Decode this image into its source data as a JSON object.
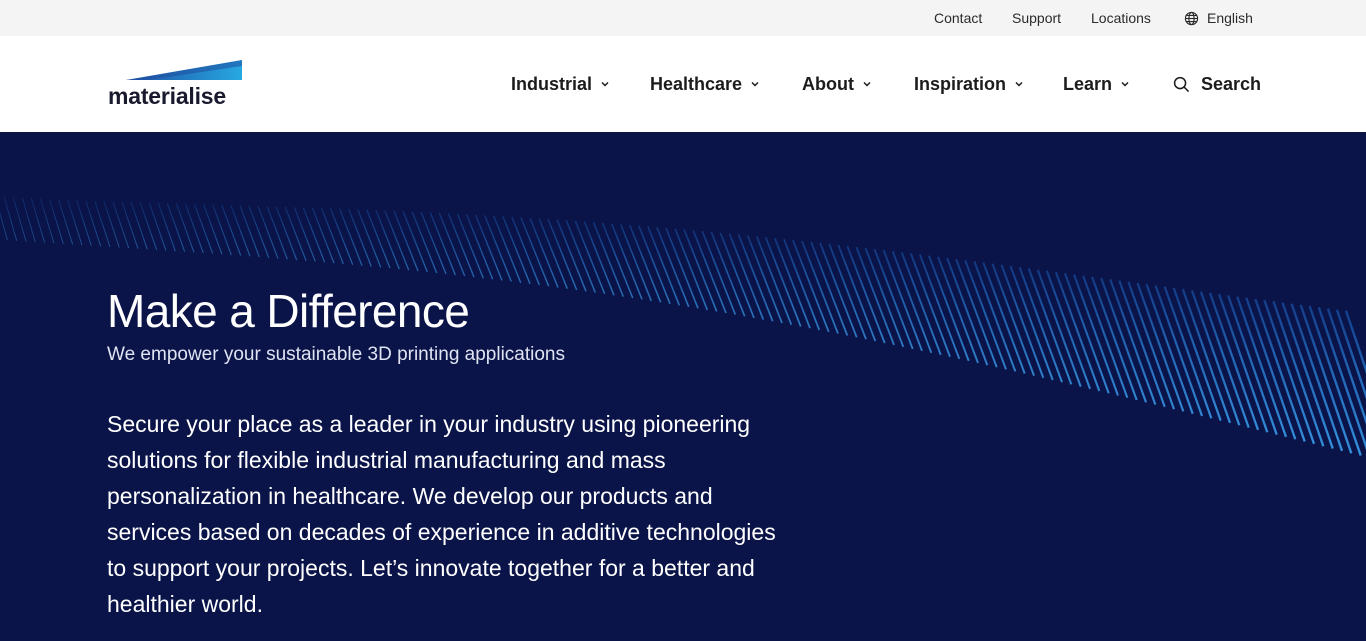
{
  "utility_nav": {
    "contact": "Contact",
    "support": "Support",
    "locations": "Locations",
    "language": "English",
    "language_icon": "globe-icon"
  },
  "logo": {
    "text": "materialise",
    "colors": {
      "light": "#27a8e0",
      "dark": "#1f4fa3"
    }
  },
  "main_nav": {
    "items": [
      {
        "label": "Industrial"
      },
      {
        "label": "Healthcare"
      },
      {
        "label": "About"
      },
      {
        "label": "Inspiration"
      },
      {
        "label": "Learn"
      }
    ],
    "dropdown_icon": "chevron-down-icon",
    "search_label": "Search",
    "search_icon": "search-icon"
  },
  "hero": {
    "title": "Make a Difference",
    "subtitle": "We empower your sustainable 3D printing applications",
    "body": "Secure your place as a leader in your industry using pioneering solutions for flexible industrial manufacturing and mass personalization in healthcare. We develop our products and services based on decades of experience in additive technologies to support your projects. Let’s innovate together for a better and healthier world.",
    "background_color": "#0a1449",
    "wave_color": "#2a8fe0"
  }
}
